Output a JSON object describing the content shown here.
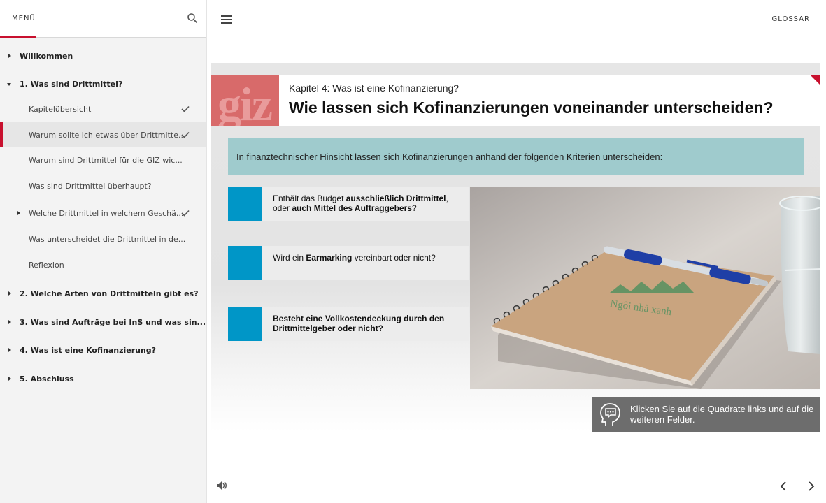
{
  "sidebar": {
    "title": "MENÜ",
    "items": [
      {
        "label": "Willkommen"
      },
      {
        "label": "1. Was sind Drittmittel?"
      },
      {
        "label": "Kapitelübersicht"
      },
      {
        "label": "Warum sollte ich etwas über Drittmitte..."
      },
      {
        "label": "Warum sind Drittmittel für die GIZ wic..."
      },
      {
        "label": "Was sind Drittmittel überhaupt?"
      },
      {
        "label": "Welche Drittmittel in welchem Geschä..."
      },
      {
        "label": "Was unterscheidet die Drittmittel in de..."
      },
      {
        "label": "Reflexion"
      },
      {
        "label": "2. Welche Arten von Drittmitteln gibt es?"
      },
      {
        "label": "3. Was sind Aufträge bei InS und was sin..."
      },
      {
        "label": "4. Was ist eine Kofinanzierung?"
      },
      {
        "label": "5. Abschluss"
      }
    ]
  },
  "topbar": {
    "glossary": "GLOSSAR"
  },
  "slide": {
    "logo": "giz",
    "subtitle": "Kapitel 4: Was ist eine Kofinanzierung?",
    "title": "Wie lassen sich Kofinanzierungen voneinander unterscheiden?",
    "intro": "In finanztechnischer Hinsicht lassen sich Kofinanzierungen anhand der folgenden Kriterien unterscheiden:",
    "criteria": [
      {
        "p1": "Enthält das Budget ",
        "b1": "ausschließlich Drittmittel",
        "p2": ", oder ",
        "b2": "auch Mittel des Auftraggebers",
        "p3": "?"
      },
      {
        "p1": "Wird ein ",
        "b1": "Earmarking",
        "p2": " vereinbart oder nicht?"
      },
      {
        "b1": "Besteht eine Vollkostendeckung durch den Drittmittelgeber oder nicht?"
      }
    ],
    "notebook_text": "Ngôi nhà xanh",
    "hint": "Klicken Sie auf die Quadrate links und auf die weiteren Felder."
  },
  "colors": {
    "accent_red": "#c8102e",
    "square_blue": "#0096c7",
    "intro_teal": "#9fcbcd",
    "hint_gray": "#6d6d6d"
  }
}
